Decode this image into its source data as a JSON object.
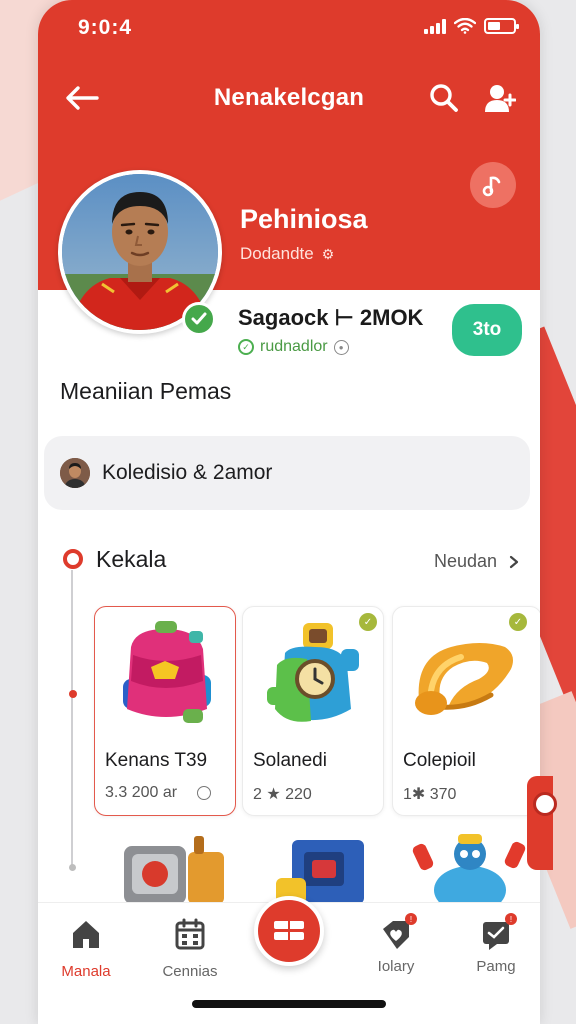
{
  "status_bar": {
    "time": "9:0:4"
  },
  "app_bar": {
    "title": "Nenakelcgan"
  },
  "profile": {
    "name": "Pehiniosa",
    "subtitle": "Dodandte",
    "stat_main": "Sagaock ⊢ 2MOK",
    "stat_sub": "rudnadlor",
    "follow_label": "3to"
  },
  "section_heading": "Meaniian Pemas",
  "collection": {
    "label": "Koledisio & 2amor"
  },
  "kekala": {
    "title": "Kekala",
    "view_all": "Neudan",
    "items": [
      {
        "name": "Kenans T39",
        "meta": "3.3 200 ar",
        "icon": "backpack-icon"
      },
      {
        "name": "Solanedi",
        "meta": "2 ★ 220",
        "icon": "robot-watch-icon"
      },
      {
        "name": "Colepioil",
        "meta": "1✱ 370",
        "icon": "gold-ring-icon"
      }
    ]
  },
  "bottom_nav": {
    "items": [
      {
        "label": "Manala",
        "icon": "home-icon"
      },
      {
        "label": "Cennias",
        "icon": "calendar-icon"
      },
      {
        "label": "Iolary",
        "icon": "heart-tag-icon"
      },
      {
        "label": "Pamg",
        "icon": "message-icon"
      }
    ]
  },
  "colors": {
    "accent": "#de3b2c",
    "success": "#2fc08d",
    "verified": "#45a84b"
  }
}
